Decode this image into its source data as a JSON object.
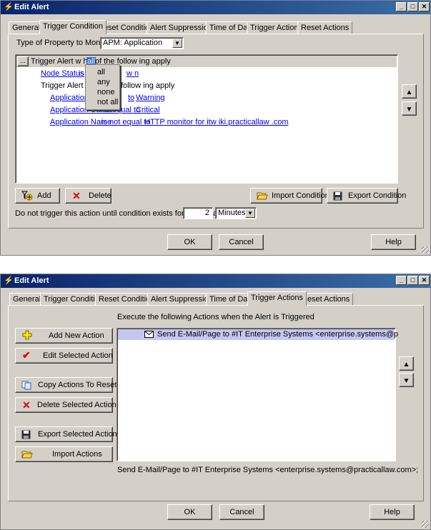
{
  "top": {
    "title": "Edit Alert",
    "tabs": [
      "General",
      "Trigger Condition",
      "Reset Condition",
      "Alert Suppression",
      "Time of Day",
      "Trigger Actions",
      "Reset Actions"
    ],
    "property_label": "Type of Property to Monitor:",
    "property_value": "APM: Application",
    "condition_row_prefix": "Trigger Alert w hen",
    "condition_row_selected": "all",
    "condition_row_suffix": "of the follow ing apply",
    "ellipsis": "...",
    "node_status_link": "Node Status",
    "node_status_op": "is",
    "node_status_tail": "w n",
    "nested_prefix": "Trigger Alert w",
    "nested_suffix": "follow ing apply",
    "app_status_1_link": "Application S",
    "app_status_1_op": "to",
    "app_status_1_value": "Warning",
    "app_status_2_link": "Application Status",
    "app_status_2_op": "is equal to",
    "app_status_2_value": "Critical",
    "app_name_link": "Application Name",
    "app_name_op": "is not equal to",
    "app_name_value": "HTTP monitor for itw iki.practicallaw .com",
    "dropdown_options": [
      "all",
      "any",
      "none",
      "not all"
    ],
    "add_label": "Add",
    "delete_label": "Delete",
    "import_label": "Import Condition",
    "export_label": "Export Condition",
    "delay_label": "Do not trigger this action until condition exists for more than",
    "delay_value": "2",
    "delay_unit": "Minutes",
    "ok_label": "OK",
    "cancel_label": "Cancel",
    "help_label": "Help"
  },
  "bottom": {
    "title": "Edit Alert",
    "tabs": [
      "General",
      "Trigger Condition",
      "Reset Condition",
      "Alert Suppression",
      "Time of Day",
      "Trigger Actions",
      "Reset Actions"
    ],
    "header": "Execute the following Actions when the Alert is Triggered",
    "add_new_action": "Add New Action",
    "edit_selected_action": "Edit Selected Action",
    "copy_actions_to_reset": "Copy Actions To Reset",
    "delete_selected_actions": "Delete Selected Actions",
    "export_selected_actions": "Export Selected Actions",
    "import_actions": "Import Actions",
    "action_item": "Send E-Mail/Page to #IT Enterprise Systems <enterprise.systems@p",
    "summary": "Send E-Mail/Page to #IT Enterprise Systems <enterprise.systems@practicallaw.com>;",
    "ok_label": "OK",
    "cancel_label": "Cancel",
    "help_label": "Help"
  },
  "colors": {
    "title_start": "#0a246a",
    "title_end": "#3a6ea5",
    "face": "#d4d0c8",
    "selection": "#c6c6f0",
    "link": "#0000ee"
  }
}
